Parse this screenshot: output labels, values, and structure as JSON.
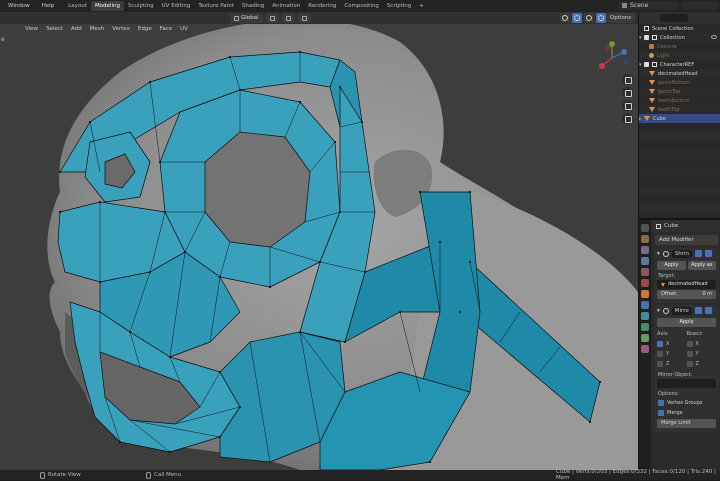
{
  "menu": [
    "Window",
    "Help"
  ],
  "workspaces": [
    "Layout",
    "Modeling",
    "Sculpting",
    "UV Editing",
    "Texture Paint",
    "Shading",
    "Animation",
    "Rendering",
    "Compositing",
    "Scripting"
  ],
  "active_workspace": "Modeling",
  "add_tab": "+",
  "scene_name": "Scene",
  "header": {
    "transform_orientation": "Global",
    "options": "Options"
  },
  "edit_menu": [
    "View",
    "Select",
    "Add",
    "Mesh",
    "Vertex",
    "Edge",
    "Face",
    "UV"
  ],
  "left_glyph": "e",
  "outliner": {
    "title": "Scene Collection",
    "rows": [
      {
        "label": "Scene Collection",
        "kind": "scene"
      },
      {
        "label": "Collection",
        "kind": "collection"
      },
      {
        "label": "Camera",
        "kind": "camera",
        "dim": true
      },
      {
        "label": "Light",
        "kind": "light",
        "dim": true
      },
      {
        "label": "CharacterREF",
        "kind": "collection"
      },
      {
        "label": "decimatedHead",
        "kind": "mesh"
      },
      {
        "label": "gumsBottom",
        "kind": "mesh",
        "dim": true
      },
      {
        "label": "gumsTop",
        "kind": "mesh",
        "dim": true
      },
      {
        "label": "teethBottom",
        "kind": "mesh",
        "dim": true
      },
      {
        "label": "teethTop",
        "kind": "mesh",
        "dim": true
      },
      {
        "label": "Cube",
        "kind": "mesh",
        "selected": true
      }
    ]
  },
  "properties": {
    "object_name": "Cube",
    "add_modifier": "Add Modifier",
    "shrinkwrap": {
      "name": "Shrin",
      "apply": "Apply",
      "apply_as": "Apply as",
      "target_label": "Target:",
      "target_value": "decimatedHead",
      "offset_label": "Offset:",
      "offset_value": "0 m"
    },
    "mirror": {
      "name": "Mirro",
      "apply": "Apply",
      "axis_label": "Axis:",
      "bisect_label": "Bisect:",
      "axes": [
        "X",
        "Y",
        "Z"
      ],
      "axis_on": [
        true,
        false,
        false
      ],
      "mirror_object_label": "Mirror Object:",
      "options_label": "Options:",
      "vertex_groups": "Vertex Groups",
      "merge": "Merge",
      "merge_limit": "Merge Limit"
    }
  },
  "statusbar": {
    "left": "Rotate View",
    "middle": "Call Menu",
    "stats": "Cube | Verts:0/203 | Edges:0/332 | Faces:0/120 | Tris:240 | Mem"
  },
  "colors": {
    "retopo_face": "#3aa1bd",
    "retopo_face_dark": "#1e8aa8",
    "sculpt": "#8f8f8f",
    "selection": "#334d80",
    "accent": "#4772b3"
  }
}
